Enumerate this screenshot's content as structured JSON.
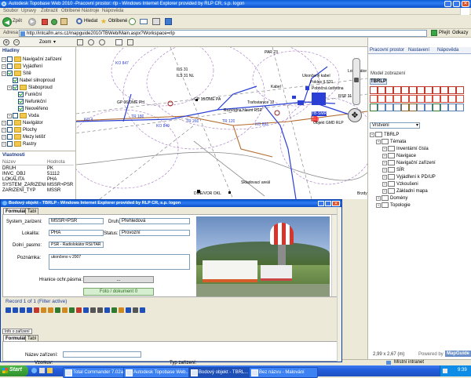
{
  "ie": {
    "title": "Autodesk Topobase Web 2010 -Pracovní prostor: rlp - Windows Internet Explorer provided by ŘLP ČR, s.p. logon",
    "menu": [
      "Soubor",
      "Úpravy",
      "Zobrazit",
      "Oblíbené",
      "Nástroje",
      "Nápověda"
    ],
    "search_label": "Hledat",
    "favorites_label": "Oblíbené",
    "address_label": "Adresa",
    "address_value": "http://intcafm.ans.cz/mapguide2010/TBWeb/Main.aspx?Workspace=rlp",
    "go_label": "Přejít",
    "links_label": "Odkazy",
    "zoom_label": "Zoom",
    "status_text": "Místní intranet"
  },
  "layers": {
    "title": "Hladiny",
    "items": [
      {
        "label": "Navigační zařízení",
        "kind": "folder",
        "indent": 0,
        "checked": false
      },
      {
        "label": "Vyjádření",
        "kind": "folder",
        "indent": 0,
        "checked": false
      },
      {
        "label": "Sítě",
        "kind": "folder",
        "indent": 0,
        "checked": true
      },
      {
        "label": "Nabel silnoproud",
        "kind": "item",
        "indent": 1,
        "checked": true
      },
      {
        "label": "Slaboproud",
        "kind": "folder",
        "indent": 1,
        "checked": true
      },
      {
        "label": "Funkční",
        "kind": "item",
        "indent": 2,
        "checked": true
      },
      {
        "label": "Nefunkční",
        "kind": "item",
        "indent": 2,
        "checked": true
      },
      {
        "label": "Neověřeno",
        "kind": "item",
        "indent": 2,
        "checked": true
      },
      {
        "label": "Voda",
        "kind": "folder",
        "indent": 1,
        "checked": false
      },
      {
        "label": "Navigátor",
        "kind": "folder",
        "indent": 0,
        "checked": false
      },
      {
        "label": "Plochy",
        "kind": "folder",
        "indent": 0,
        "checked": false
      },
      {
        "label": "Mezy letišť",
        "kind": "folder",
        "indent": 0,
        "checked": false
      },
      {
        "label": "Rastry",
        "kind": "folder",
        "indent": 0,
        "checked": false
      }
    ]
  },
  "properties": {
    "title": "Vlastnosti",
    "col_name": "Název",
    "col_value": "Hodnota",
    "rows": [
      {
        "name": "DRUH",
        "value": "PK"
      },
      {
        "name": "INVC_OBJ",
        "value": "51112"
      },
      {
        "name": "LOKALITA",
        "value": "PHA"
      },
      {
        "name": "SYSTEM_ZARIZENI",
        "value": "MSSR+PSR"
      },
      {
        "name": "ZARIZENI_TYP",
        "value": "MSSR"
      }
    ]
  },
  "map": {
    "labels": [
      "PAR 23",
      "KO 847",
      "ILS 31",
      "ILS 31 NL",
      "Ukončený kabel",
      "Pokles ILS31",
      "GP 06/DME PH",
      "GP 18/DME PA",
      "Trafostanice 12",
      "Rozvodna hlavní RSP",
      "Pobočná ústředna",
      "TB-SMR",
      "Kabel",
      "Objekt GMD ŘLP",
      "Skladovací areál",
      "DME/VOR OKL",
      "Brzdy",
      "KO 849",
      "KO 892",
      "TR 260",
      "TR 180",
      "TR 120",
      "KO 4",
      "RSP 31",
      "Lokalizátor"
    ],
    "scale_text": "2,99 x 2,67 (m)"
  },
  "right_panel": {
    "tabs": [
      "Pracovní prostor",
      "Nastavení",
      "Nápověda"
    ],
    "model_label": "Model zobrazení",
    "model_title": "TBRLP",
    "filter_select": "Vrstvení",
    "tree": [
      {
        "label": "TBRLP",
        "indent": 0
      },
      {
        "label": "Témata",
        "indent": 1
      },
      {
        "label": "Inventární čísla",
        "indent": 2
      },
      {
        "label": "Navigace",
        "indent": 2
      },
      {
        "label": "Navigační zařízení",
        "indent": 2
      },
      {
        "label": "SÍR",
        "indent": 2
      },
      {
        "label": "Vyjádření k PD/UP",
        "indent": 2
      },
      {
        "label": "Vzkoušeni",
        "indent": 2
      },
      {
        "label": "Základní mapa",
        "indent": 2
      },
      {
        "label": "Domény",
        "indent": 1
      },
      {
        "label": "Topologie",
        "indent": 1
      }
    ],
    "powered_by": "Powered by",
    "powered_brand": "MapGuide"
  },
  "popup": {
    "title": "Bodový objekt - TBRLP - Windows Internet Explorer provided by ŘLP ČR, s.p. logon",
    "tabs": [
      "Formulář",
      "Tabl"
    ],
    "fields": {
      "system_label": "System_zarizeni:",
      "system_value": "MSSR+PSR",
      "druh_label": "Druh:",
      "druh_value": "Přehledová",
      "lokalita_label": "Lokalita:",
      "lokalita_value": "PHA",
      "status_label": "Status:",
      "status_value": "Provozní",
      "doln_label": "Dolní_pasmo:",
      "doln_value": "PSR - Radiolokátor RSI/TAR",
      "poznamka_label": "Poznámka:",
      "poznamka_value": "ukončeno v 2007",
      "nazev_label": "Hranice ochr.pásma:",
      "nazev_value": "...",
      "foto_button": "Foto / dokument 0"
    },
    "record_text": "Record 1 of 1 (Filter active)",
    "lower_tab": "Info o zařízení",
    "lower_tabs": [
      "Formulář",
      "Tabl"
    ],
    "lower_field1": "Název zařízení:",
    "lower_field2": "Vzorkuv:",
    "lower_field3": "Typ zařízení:"
  },
  "taskbar": {
    "start_label": "Start",
    "buttons": [
      "Total Commander 7.02a ...",
      "Autodesk Topobase Web...",
      "Bodový objekt - TBRL...",
      "Bez názvu - Malování"
    ],
    "clock": "9:39"
  },
  "colors": {
    "xp_blue": "#245edb",
    "map_bg": "#ffffff",
    "cable_blue": "#2a3fd6",
    "cable_brown": "#b36a2d",
    "cable_purple": "#8a4fb0"
  }
}
